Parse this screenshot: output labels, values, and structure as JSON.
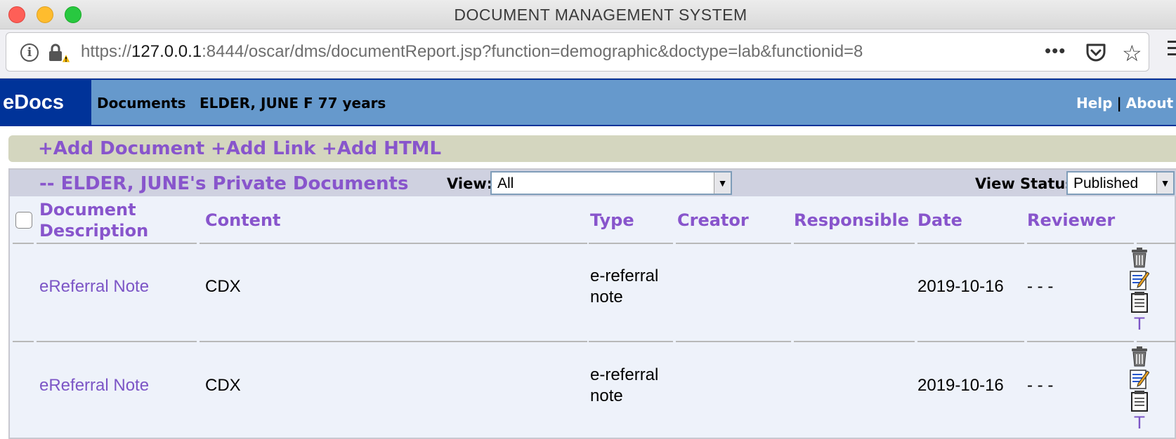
{
  "window": {
    "title": "DOCUMENT MANAGEMENT SYSTEM"
  },
  "browser": {
    "url_prefix": "https://",
    "url_host": "127.0.0.1",
    "url_rest": ":8444/oscar/dms/documentReport.jsp?function=demographic&doctype=lab&functionid=8",
    "more_label": "•••"
  },
  "header": {
    "brand": "eDocs",
    "section": "Documents",
    "patient": "ELDER, JUNE F 77 years",
    "help": "Help",
    "separator": "|",
    "about": "About"
  },
  "add_bar": {
    "add_document": "+Add Document",
    "add_link": "+Add Link",
    "add_html": "+Add HTML"
  },
  "panel": {
    "title": "-- ELDER, JUNE's Private Documents",
    "view_label": "View:",
    "view_value": "All",
    "status_label": "View Status",
    "status_value": "Published"
  },
  "columns": {
    "description_1": "Document",
    "description_2": "Description",
    "content": "Content",
    "type": "Type",
    "creator": "Creator",
    "responsible": "Responsible",
    "date": "Date",
    "reviewer": "Reviewer"
  },
  "rows": [
    {
      "description": "eReferral Note",
      "content": "CDX",
      "type_1": "e-referral",
      "type_2": "note",
      "creator": "",
      "responsible": "",
      "date": "2019-10-16",
      "reviewer": "- - -",
      "t_label": "T"
    },
    {
      "description": "eReferral Note",
      "content": "CDX",
      "type_1": "e-referral",
      "type_2": "note",
      "creator": "",
      "responsible": "",
      "date": "2019-10-16",
      "reviewer": "- - -",
      "t_label": "T"
    }
  ],
  "icons": [
    "trash-icon",
    "edit-icon",
    "annotation-icon"
  ],
  "colors": {
    "brand_bg": "#003399",
    "header_bg": "#6699cc",
    "link": "#8855cc",
    "add_bar": "#d4d6bf"
  }
}
